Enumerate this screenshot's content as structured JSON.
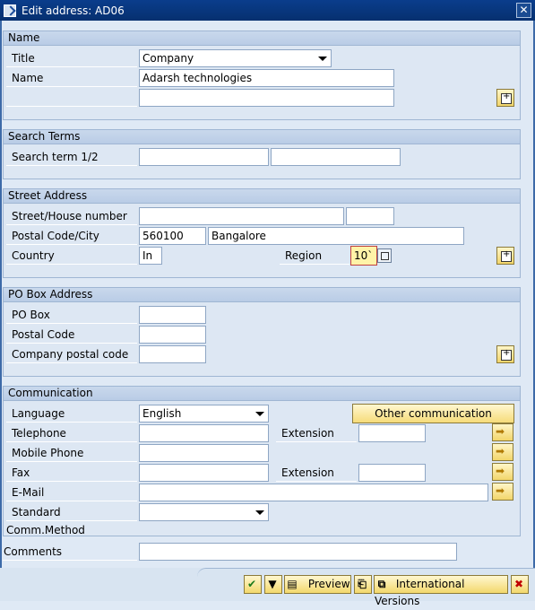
{
  "window": {
    "title": "Edit address:  AD06",
    "close_symbol": "✕"
  },
  "name_group": {
    "header": "Name",
    "title_label": "Title",
    "title_value": "Company",
    "name_label": "Name",
    "name_value": "Adarsh technologies",
    "name2_value": ""
  },
  "search_group": {
    "header": "Search Terms",
    "label": "Search term 1/2",
    "term1": "",
    "term2": ""
  },
  "street_group": {
    "header": "Street Address",
    "street_label": "Street/House number",
    "street_value": "",
    "house_value": "",
    "postal_label": "Postal Code/City",
    "postal_value": "560100",
    "city_value": "Bangalore",
    "country_label": "Country",
    "country_value": "In",
    "region_label": "Region",
    "region_value": "10`"
  },
  "pobox_group": {
    "header": "PO Box Address",
    "pobox_label": "PO Box",
    "postal_label": "Postal Code",
    "company_postal_label": "Company postal code"
  },
  "comm_group": {
    "header": "Communication",
    "language_label": "Language",
    "language_value": "English",
    "other_comm_button": "Other communication",
    "telephone_label": "Telephone",
    "extension_label": "Extension",
    "mobile_label": "Mobile Phone",
    "fax_label": "Fax",
    "fax_extension_label": "Extension",
    "email_label": "E-Mail",
    "std_method_label": "Standard Comm.Method"
  },
  "comments_label": "Comments",
  "toolbar": {
    "preview_label": "Preview",
    "intl_label": "International Versions"
  }
}
